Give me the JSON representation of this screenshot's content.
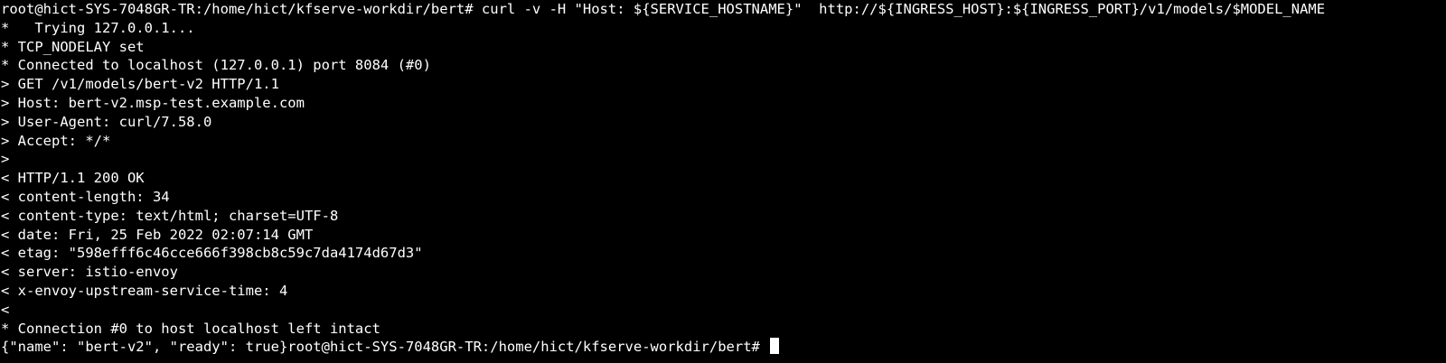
{
  "terminal": {
    "lines": [
      "root@hict-SYS-7048GR-TR:/home/hict/kfserve-workdir/bert# curl -v -H \"Host: ${SERVICE_HOSTNAME}\"  http://${INGRESS_HOST}:${INGRESS_PORT}/v1/models/$MODEL_NAME",
      "*   Trying 127.0.0.1...",
      "* TCP_NODELAY set",
      "* Connected to localhost (127.0.0.1) port 8084 (#0)",
      "> GET /v1/models/bert-v2 HTTP/1.1",
      "> Host: bert-v2.msp-test.example.com",
      "> User-Agent: curl/7.58.0",
      "> Accept: */*",
      ">",
      "< HTTP/1.1 200 OK",
      "< content-length: 34",
      "< content-type: text/html; charset=UTF-8",
      "< date: Fri, 25 Feb 2022 02:07:14 GMT",
      "< etag: \"598efff6c46cce666f398cb8c59c7da4174d67d3\"",
      "< server: istio-envoy",
      "< x-envoy-upstream-service-time: 4",
      "<",
      "* Connection #0 to host localhost left intact",
      "{\"name\": \"bert-v2\", \"ready\": true}root@hict-SYS-7048GR-TR:/home/hict/kfserve-workdir/bert# "
    ],
    "colors": {
      "background": "#000000",
      "foreground": "#ffffff"
    }
  }
}
